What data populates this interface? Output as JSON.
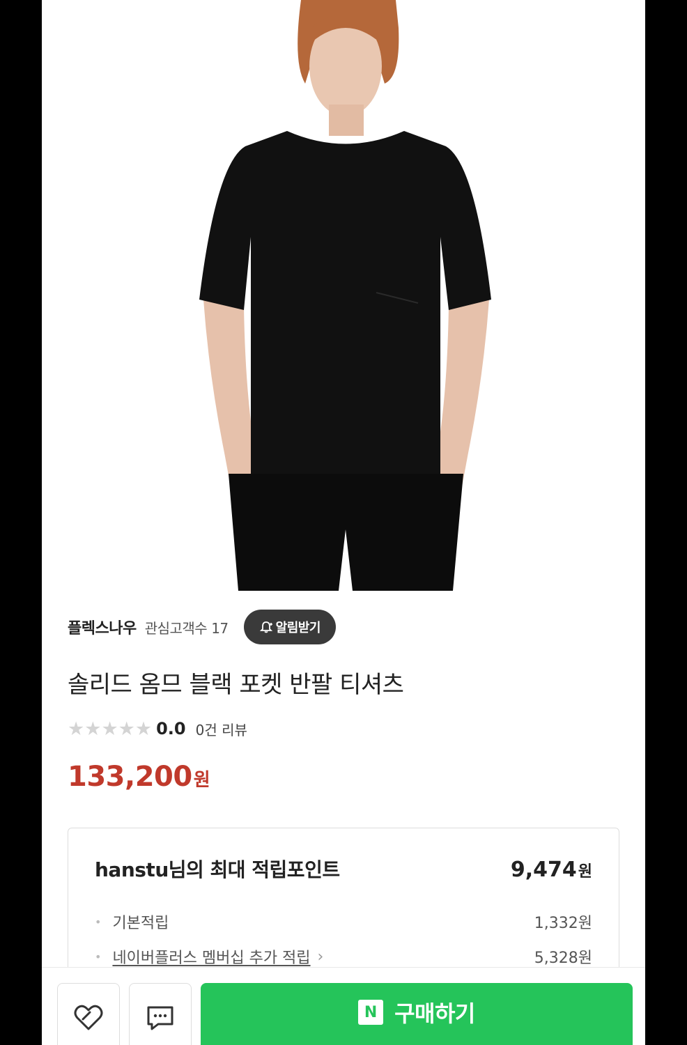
{
  "store": {
    "name": "플렉스나우",
    "interest_label": "관심고객수",
    "interest_count": "17",
    "notify_label": "알림받기"
  },
  "product": {
    "title": "솔리드 옴므 블랙 포켓 반팔 티셔츠",
    "rating": "0.0",
    "review_label": "0건 리뷰",
    "stars_filled": 0,
    "stars_total": 5,
    "price": "133,200",
    "price_unit": "원"
  },
  "points": {
    "title": "hanstu님의 최대 적립포인트",
    "total": "9,474",
    "unit": "원",
    "items": [
      {
        "label": "기본적립",
        "value": "1,332원"
      },
      {
        "label": "네이버플러스 멤버십 추가 적립",
        "value": "5,328원"
      }
    ]
  },
  "bottom_bar": {
    "like_icon": "heart-icon",
    "talk_icon": "chat-icon",
    "buy_badge": "N",
    "buy_label": "구매하기"
  },
  "colors": {
    "price": "#c0392b",
    "buy_button": "#25c45a",
    "notify_button": "#3a3a3a",
    "star_empty": "#d4d4d4"
  }
}
